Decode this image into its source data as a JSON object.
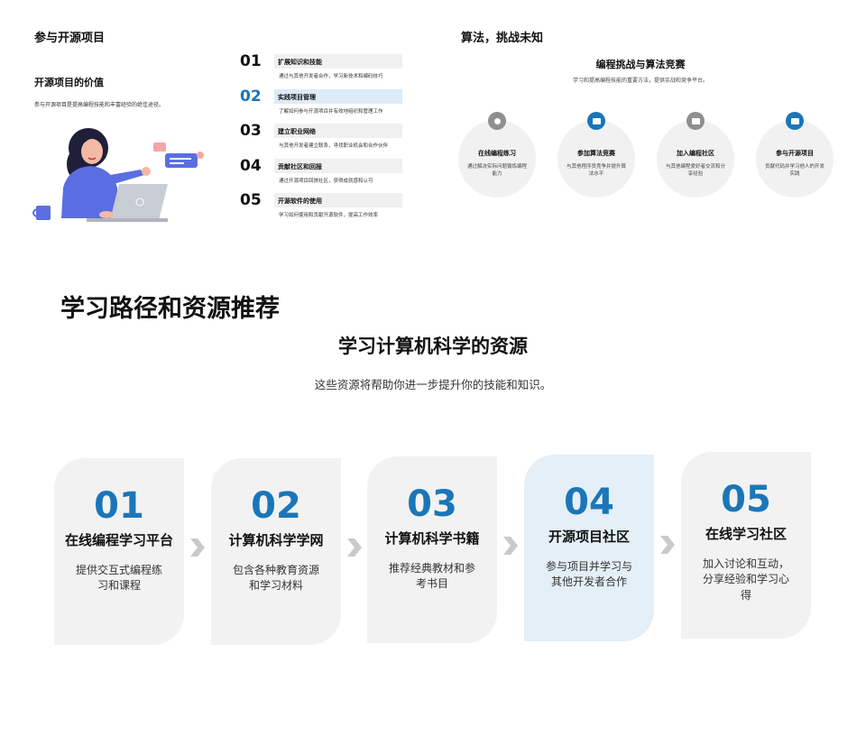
{
  "slide1": {
    "title": "参与开源项目",
    "subtitle": "开源项目的价值",
    "description": "参与开源项目是提高编程技能和丰富经验的绝佳途径。",
    "items": [
      {
        "num": "01",
        "head": "扩展知识和技能",
        "body": "通过与其他开发者合作，学习新技术和编码技巧"
      },
      {
        "num": "02",
        "head": "实践项目管理",
        "body": "了解如何参与开源项目并有效地组织和管理工作"
      },
      {
        "num": "03",
        "head": "建立职业网络",
        "body": "与其他开发者建立联系，寻找职业机会和合作伙伴"
      },
      {
        "num": "04",
        "head": "贡献社区和回报",
        "body": "通过开源项目回馈社区，获得成就感和认可"
      },
      {
        "num": "05",
        "head": "开源软件的使用",
        "body": "学习如何使用和贡献开源软件，提高工作效率"
      }
    ]
  },
  "slide2": {
    "title": "算法，挑战未知",
    "subtitle": "编程挑战与算法竞赛",
    "description": "学习和提高编程技能的重要方法，提供实战和竞争平台。",
    "items": [
      {
        "label": "在线编程练习",
        "desc": "通过解决实际问题锻炼编程能力",
        "icon": "target-icon",
        "color": "#8f8f8f"
      },
      {
        "label": "参加算法竞赛",
        "desc": "与其他程序员竞争并提升算法水平",
        "icon": "image-icon",
        "color": "#1b76b8"
      },
      {
        "label": "加入编程社区",
        "desc": "与其他编程爱好者交流和分享经验",
        "icon": "folder-icon",
        "color": "#8f8f8f"
      },
      {
        "label": "参与开源项目",
        "desc": "贡献代码并学习他人的开发实践",
        "icon": "car-icon",
        "color": "#1b76b8"
      }
    ]
  },
  "slide3": {
    "title": "学习路径和资源推荐",
    "subtitle": "学习计算机科学的资源",
    "description": "这些资源将帮助你进一步提升你的技能和知识。",
    "cards": [
      {
        "num": "01",
        "title": "在线编程学习平台",
        "desc": "提供交互式编程练习和课程"
      },
      {
        "num": "02",
        "title": "计算机科学学网",
        "desc": "包含各种教育资源和学习材料"
      },
      {
        "num": "03",
        "title": "计算机科学书籍",
        "desc": "推荐经典教材和参考书目"
      },
      {
        "num": "04",
        "title": "开源项目社区",
        "desc": "参与项目并学习与其他开发者合作"
      },
      {
        "num": "05",
        "title": "在线学习社区",
        "desc": "加入讨论和互动，分享经验和学习心得"
      }
    ]
  }
}
